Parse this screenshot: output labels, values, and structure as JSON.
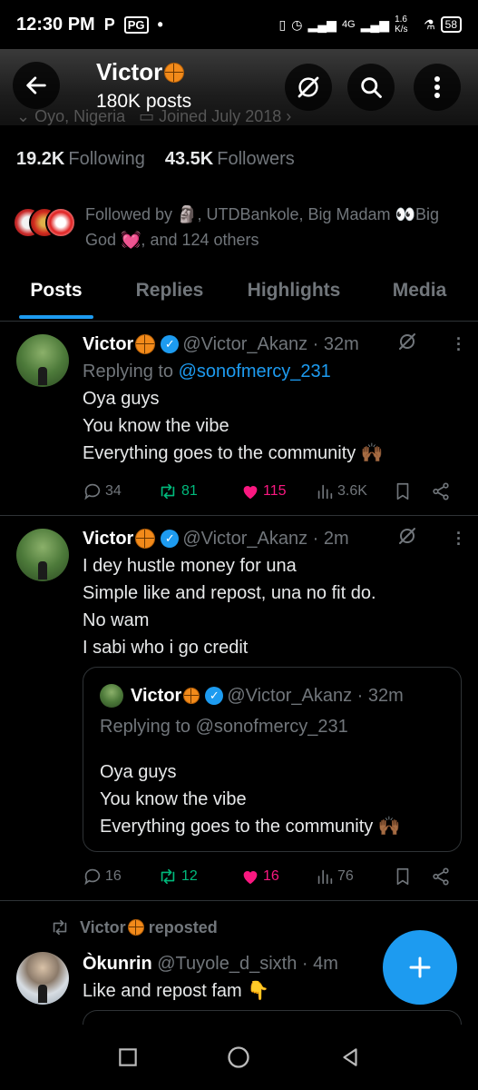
{
  "status_bar": {
    "time": "12:30 PM",
    "app_icon_p": "P",
    "app_icon_pg": "PG",
    "dot": "•",
    "network": "4G",
    "speed": "1.6 K/s",
    "battery": "58"
  },
  "header": {
    "title": "Victor",
    "subtitle": "180K posts",
    "ghost_location": "Oyo, Nigeria",
    "ghost_joined": "Joined July 2018"
  },
  "stats": {
    "following_count": "19.2K",
    "following_label": "Following",
    "followers_count": "43.5K",
    "followers_label": "Followers"
  },
  "followed_by": {
    "text": "Followed by 🗿, UTDBankole, Big Madam 👀Big God 💓, and 124 others"
  },
  "tabs": [
    "Posts",
    "Replies",
    "Highlights",
    "Media"
  ],
  "posts": [
    {
      "name": "Victor",
      "handle": "@Victor_Akanz",
      "time": "· 32m",
      "replying_prefix": "Replying to",
      "replying_handle": "@sonofmercy_231",
      "text": "Oya guys\nYou know the vibe\nEverything goes to the community 🙌🏾",
      "replies": "34",
      "reposts": "81",
      "likes": "115",
      "views": "3.6K"
    },
    {
      "name": "Victor",
      "handle": "@Victor_Akanz",
      "time": "· 2m",
      "text": "I dey hustle money for una\nSimple like and repost, una no fit do.\nNo wam\nI sabi who i go credit",
      "quote": {
        "name": "Victor",
        "handle": "@Victor_Akanz",
        "time": "· 32m",
        "replying": "Replying to @sonofmercy_231",
        "text": "Oya guys\nYou know the vibe\nEverything goes to the community 🙌🏾"
      },
      "replies": "16",
      "reposts": "12",
      "likes": "16",
      "views": "76"
    },
    {
      "repost_by": "Victor",
      "repost_label": "reposted",
      "name": "Òkunrin",
      "handle": "@Tuyole_d_sixth",
      "time": "· 4m",
      "text": "Like and repost fam 👇"
    }
  ],
  "colors": {
    "accent": "#1d9bf0",
    "like": "#f91880",
    "repost": "#00ba7c",
    "muted": "#71767b"
  }
}
